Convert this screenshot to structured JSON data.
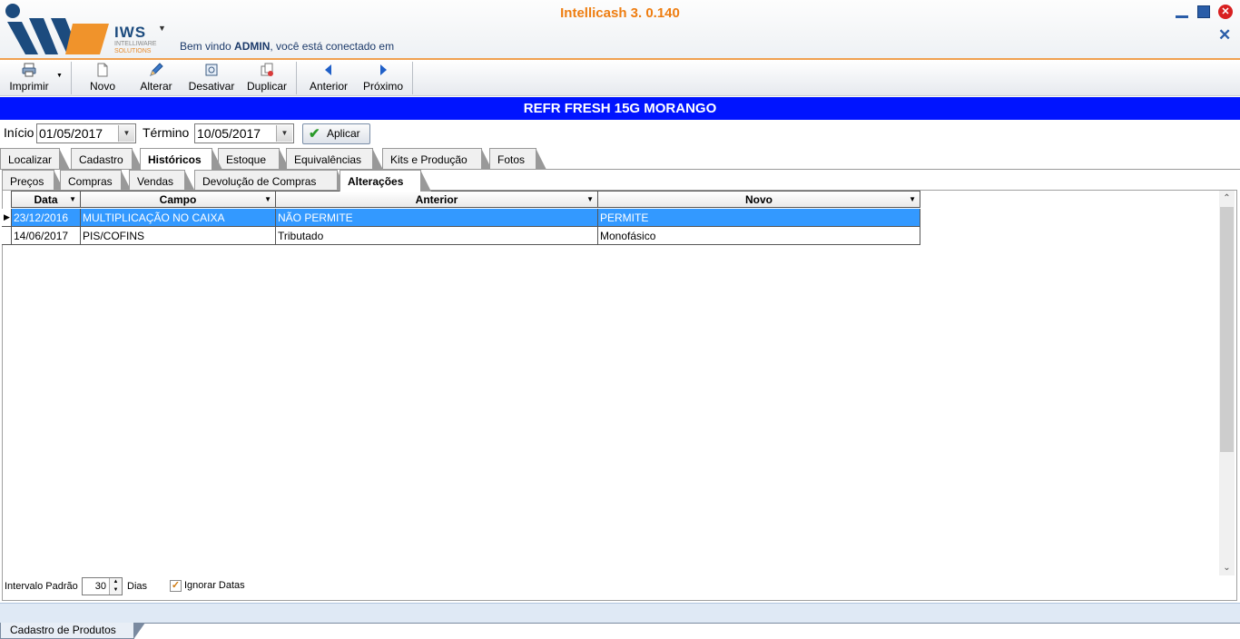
{
  "header": {
    "app_title": "Intellicash 3. 0.140",
    "logo_name": "IWS",
    "logo_sub1": "INTELLIWARE",
    "logo_sub2": "SOLUTIONS",
    "welcome_prefix": "Bem vindo ",
    "welcome_user": "ADMIN",
    "welcome_suffix": ", você está conectado em"
  },
  "toolbar": {
    "items": [
      {
        "label": "Imprimir",
        "icon": "printer-icon"
      },
      {
        "label": "Novo",
        "icon": "new-document-icon"
      },
      {
        "label": "Alterar",
        "icon": "pencil-icon"
      },
      {
        "label": "Desativar",
        "icon": "deactivate-icon"
      },
      {
        "label": "Duplicar",
        "icon": "duplicate-icon"
      },
      {
        "label": "Anterior",
        "icon": "arrow-left-icon"
      },
      {
        "label": "Próximo",
        "icon": "arrow-right-icon"
      }
    ]
  },
  "banner": {
    "product": "REFR FRESH 15G MORANGO"
  },
  "filters": {
    "inicio_label": "Início",
    "inicio_value": "01/05/2017",
    "termino_label": "Término",
    "termino_value": "10/05/2017",
    "aplicar_label": "Aplicar"
  },
  "main_tabs": [
    "Localizar",
    "Cadastro",
    "Históricos",
    "Estoque",
    "Equivalências",
    "Kits e Produção",
    "Fotos"
  ],
  "main_tab_active": "Históricos",
  "sub_tabs": [
    "Preços",
    "Compras",
    "Vendas",
    "Devolução de Compras",
    "Alterações"
  ],
  "sub_tab_active": "Alterações",
  "grid": {
    "columns": [
      "Data",
      "Campo",
      "Anterior",
      "Novo"
    ],
    "rows": [
      {
        "data": "23/12/2016",
        "campo": "MULTIPLICAÇÃO NO CAIXA",
        "anterior": "NÃO PERMITE",
        "novo": "PERMITE",
        "selected": true
      },
      {
        "data": "14/06/2017",
        "campo": "PIS/COFINS",
        "anterior": "Tributado",
        "novo": "Monofásico",
        "selected": false
      }
    ]
  },
  "footer": {
    "intervalo_label": "Intervalo Padrão",
    "intervalo_value": "30",
    "dias_label": "Dias",
    "ignorar_label": "Ignorar Datas",
    "ignorar_checked": true
  },
  "status": {
    "bottom_tab": "Cadastro de Produtos"
  },
  "colors": {
    "accent_orange": "#ee7d10",
    "banner_blue": "#0014ff",
    "selection_blue": "#3399ff"
  }
}
